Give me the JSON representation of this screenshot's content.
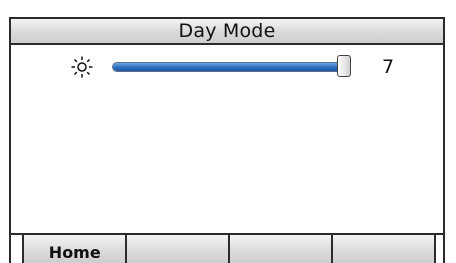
{
  "header": {
    "title": "Day Mode"
  },
  "brightness": {
    "icon": "brightness-sun-icon",
    "value": "7",
    "level_fraction": 1.0
  },
  "softkeys": [
    {
      "label": "Home"
    },
    {
      "label": ""
    },
    {
      "label": ""
    },
    {
      "label": ""
    }
  ],
  "colors": {
    "slider_fill": "#2f6fc0",
    "title_bar": "#d9d9d9",
    "border": "#2b2b2b"
  }
}
